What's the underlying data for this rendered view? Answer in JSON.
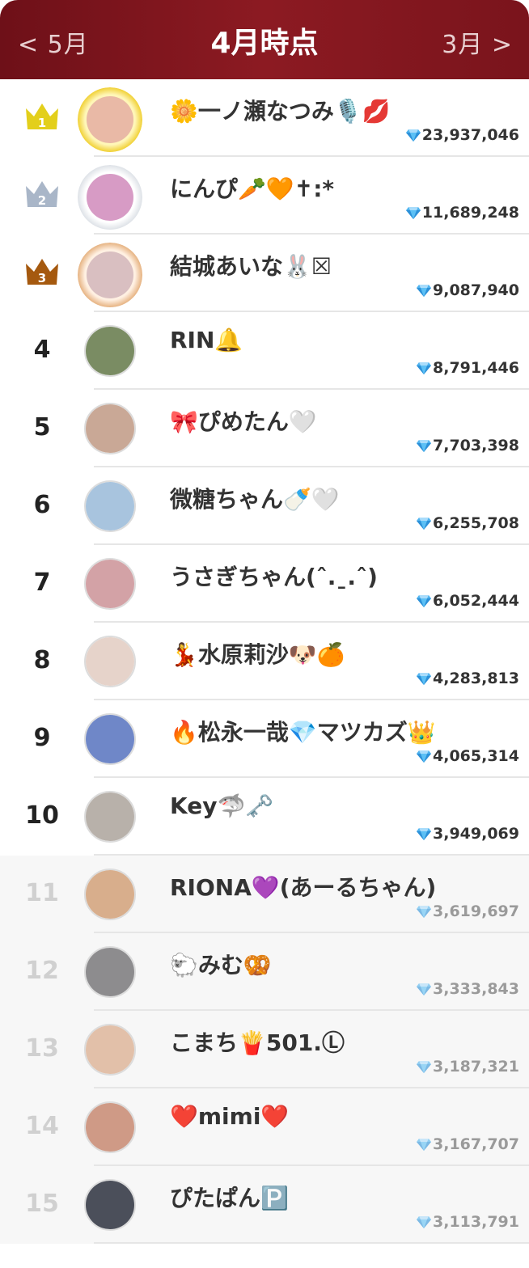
{
  "header": {
    "prev_label": "< 5月",
    "title": "4月時点",
    "next_label": "3月 >"
  },
  "icons": {
    "crown_gold": "#e3cf1b",
    "crown_silver": "#a9b6c8",
    "crown_bronze": "#a5590f",
    "gem": "diamond-icon"
  },
  "ranking": [
    {
      "rank": "1",
      "name": "🌼一ノ瀬なつみ🎙️💋",
      "score": "23,937,046",
      "medal": "gold",
      "avatar_color": "#e9b9a6"
    },
    {
      "rank": "2",
      "name": "にんぴ🥕🧡✝︎:*",
      "score": "11,689,248",
      "medal": "silver",
      "avatar_color": "#d79bc5"
    },
    {
      "rank": "3",
      "name": "結城あいな🐰☒",
      "score": "9,087,940",
      "medal": "bronze",
      "avatar_color": "#d9bfc1"
    },
    {
      "rank": "4",
      "name": "RIN🔔",
      "score": "8,791,446",
      "medal": "",
      "avatar_color": "#7a8c63"
    },
    {
      "rank": "5",
      "name": "🎀ぴめたん🤍",
      "score": "7,703,398",
      "medal": "",
      "avatar_color": "#c9a896"
    },
    {
      "rank": "6",
      "name": "微糖ちゃん🍼🤍",
      "score": "6,255,708",
      "medal": "",
      "avatar_color": "#a8c4de"
    },
    {
      "rank": "7",
      "name": "うさぎちゃん(ˆ.ˍ.ˆ)",
      "score": "6,052,444",
      "medal": "",
      "avatar_color": "#d3a2a6"
    },
    {
      "rank": "8",
      "name": "💃水原莉沙🐶🍊",
      "score": "4,283,813",
      "medal": "",
      "avatar_color": "#e6d3ca"
    },
    {
      "rank": "9",
      "name": "🔥松永一哉💎マツカズ👑",
      "score": "4,065,314",
      "medal": "",
      "avatar_color": "#6f87c8"
    },
    {
      "rank": "10",
      "name": "Key🦈🗝️",
      "score": "3,949,069",
      "medal": "",
      "avatar_color": "#b8b1aa"
    },
    {
      "rank": "11",
      "name": "RIONA💜(あーるちゃん)",
      "score": "3,619,697",
      "medal": "",
      "avatar_color": "#d8ae8c"
    },
    {
      "rank": "12",
      "name": "🐑みむ🥨",
      "score": "3,333,843",
      "medal": "",
      "avatar_color": "#8d8c8e"
    },
    {
      "rank": "13",
      "name": "こまち🍟501.Ⓛ",
      "score": "3,187,321",
      "medal": "",
      "avatar_color": "#e2c0a9"
    },
    {
      "rank": "14",
      "name": "❤️mimi❤️",
      "score": "3,167,707",
      "medal": "",
      "avatar_color": "#cf9a86"
    },
    {
      "rank": "15",
      "name": "ぴたぱん🅿️",
      "score": "3,113,791",
      "medal": "",
      "avatar_color": "#4b4f5a"
    }
  ]
}
